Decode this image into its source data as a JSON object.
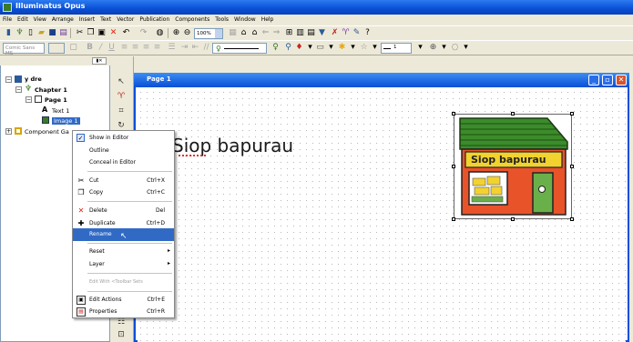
{
  "app": {
    "title": "Illuminatus Opus"
  },
  "menubar": [
    "File",
    "Edit",
    "View",
    "Arrange",
    "Insert",
    "Text",
    "Vector",
    "Publication",
    "Components",
    "Tools",
    "Window",
    "Help"
  ],
  "toolbar": {
    "zoom_value": "100%",
    "font_value": "Comic Sans MS",
    "line_width_value": "1"
  },
  "tree": {
    "root": "y dre",
    "chapter": "Chapter 1",
    "page": "Page 1",
    "text": "Text 1",
    "image": "Image 1",
    "component": "Component Ga"
  },
  "context_menu": {
    "show_in_editor": "Show in Editor",
    "outline": "Outline",
    "conceal": "Conceal in Editor",
    "cut": "Cut",
    "cut_sc": "Ctrl+X",
    "copy": "Copy",
    "copy_sc": "Ctrl+C",
    "delete": "Delete",
    "delete_sc": "Del",
    "duplicate": "Duplicate",
    "duplicate_sc": "Ctrl+D",
    "rename": "Rename",
    "reset": "Reset",
    "layer": "Layer",
    "edit_with": "Edit With <Toolbar Sets",
    "edit_actions": "Edit Actions",
    "edit_actions_sc": "Ctrl+E",
    "properties": "Properties",
    "properties_sc": "Ctrl+R"
  },
  "document": {
    "window_title": "Page 1",
    "headline": "Siop bapurau",
    "shop_sign": "Siop bapurau"
  },
  "colors": {
    "titlebar": "#0a4fd6",
    "highlight": "#316ac5",
    "shop_wall": "#e8532a",
    "shop_roof": "#3b8c2a",
    "shop_sign": "#f2d22e"
  }
}
